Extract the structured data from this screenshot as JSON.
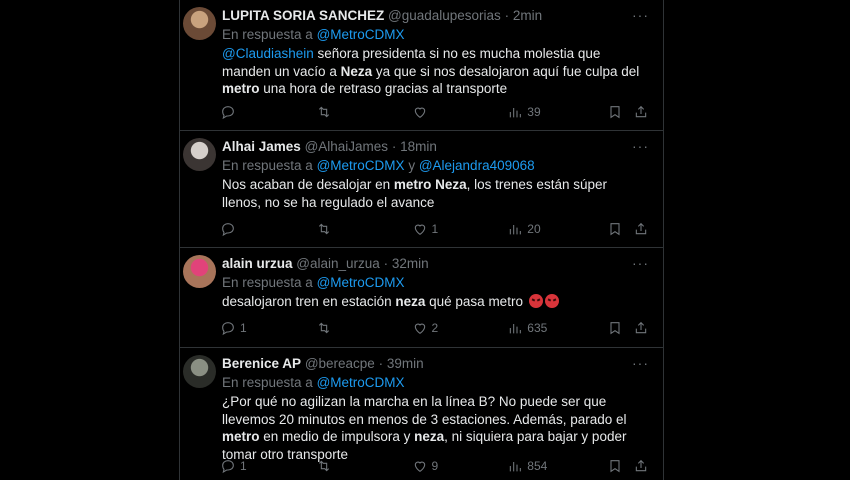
{
  "tweets": [
    {
      "name": "LUPITA SORIA SANCHEZ",
      "handle": "@guadalupesorias",
      "sep": "·",
      "time": "2min",
      "reply_prefix": "En respuesta a",
      "reply_to": "@MetroCDMX",
      "reply_and": "",
      "reply_to2": "",
      "text": [
        {
          "t": "@Claudiashein",
          "s": "mention"
        },
        {
          "t": " señora presidenta si no es mucha molestia que manden un vacío a ",
          "s": ""
        },
        {
          "t": "Neza",
          "s": "bold"
        },
        {
          "t": " ya que si nos desalojaron aquí fue culpa del ",
          "s": ""
        },
        {
          "t": "metro",
          "s": "bold"
        },
        {
          "t": " una hora de retraso gracias al transporte",
          "s": ""
        }
      ],
      "counts": {
        "replies": "",
        "retweets": "",
        "likes": "",
        "views": "39"
      },
      "avatar_colors": [
        "#c9a27e",
        "#6b4a36"
      ]
    },
    {
      "name": "Alhai James",
      "handle": "@AlhaiJames",
      "sep": "·",
      "time": "18min",
      "reply_prefix": "En respuesta a",
      "reply_to": "@MetroCDMX",
      "reply_and": "y",
      "reply_to2": "@Alejandra409068",
      "text": [
        {
          "t": "Nos acaban de desalojar en ",
          "s": ""
        },
        {
          "t": "metro Neza",
          "s": "bold"
        },
        {
          "t": ", los trenes están súper llenos, no se ha regulado el avance",
          "s": ""
        }
      ],
      "counts": {
        "replies": "",
        "retweets": "",
        "likes": "1",
        "views": "20"
      },
      "avatar_colors": [
        "#d6d0cb",
        "#3b3533"
      ]
    },
    {
      "name": "alain urzua",
      "handle": "@alain_urzua",
      "sep": "·",
      "time": "32min",
      "reply_prefix": "En respuesta a",
      "reply_to": "@MetroCDMX",
      "reply_and": "",
      "reply_to2": "",
      "text": [
        {
          "t": "desalojaron tren en estación ",
          "s": ""
        },
        {
          "t": "neza",
          "s": "bold"
        },
        {
          "t": " qué pasa metro ",
          "s": ""
        },
        {
          "t": "",
          "s": "emoji"
        },
        {
          "t": "",
          "s": "emoji"
        }
      ],
      "counts": {
        "replies": "1",
        "retweets": "",
        "likes": "2",
        "views": "635"
      },
      "avatar_colors": [
        "#e1437a",
        "#a8745a"
      ]
    },
    {
      "name": "Berenice AP",
      "handle": "@bereacpe",
      "sep": "·",
      "time": "39min",
      "reply_prefix": "En respuesta a",
      "reply_to": "@MetroCDMX",
      "reply_and": "",
      "reply_to2": "",
      "text": [
        {
          "t": "¿Por qué no agilizan la marcha en la línea B? No puede ser que llevemos 20 minutos en menos de 3 estaciones. Además, parado el ",
          "s": ""
        },
        {
          "t": "metro",
          "s": "bold"
        },
        {
          "t": " en medio de impulsora y ",
          "s": ""
        },
        {
          "t": "neza",
          "s": "bold"
        },
        {
          "t": ", ni siquiera para bajar y poder tomar otro transporte",
          "s": ""
        }
      ],
      "counts": {
        "replies": "1",
        "retweets": "",
        "likes": "9",
        "views": "854"
      },
      "avatar_colors": [
        "#8a8f83",
        "#2a2c28"
      ]
    }
  ],
  "colors": {
    "background": "#000000",
    "text": "#e7e9ea",
    "muted": "#71767b",
    "link": "#1d9bf0",
    "border": "#2f3336",
    "side": "#3a3a3a"
  }
}
